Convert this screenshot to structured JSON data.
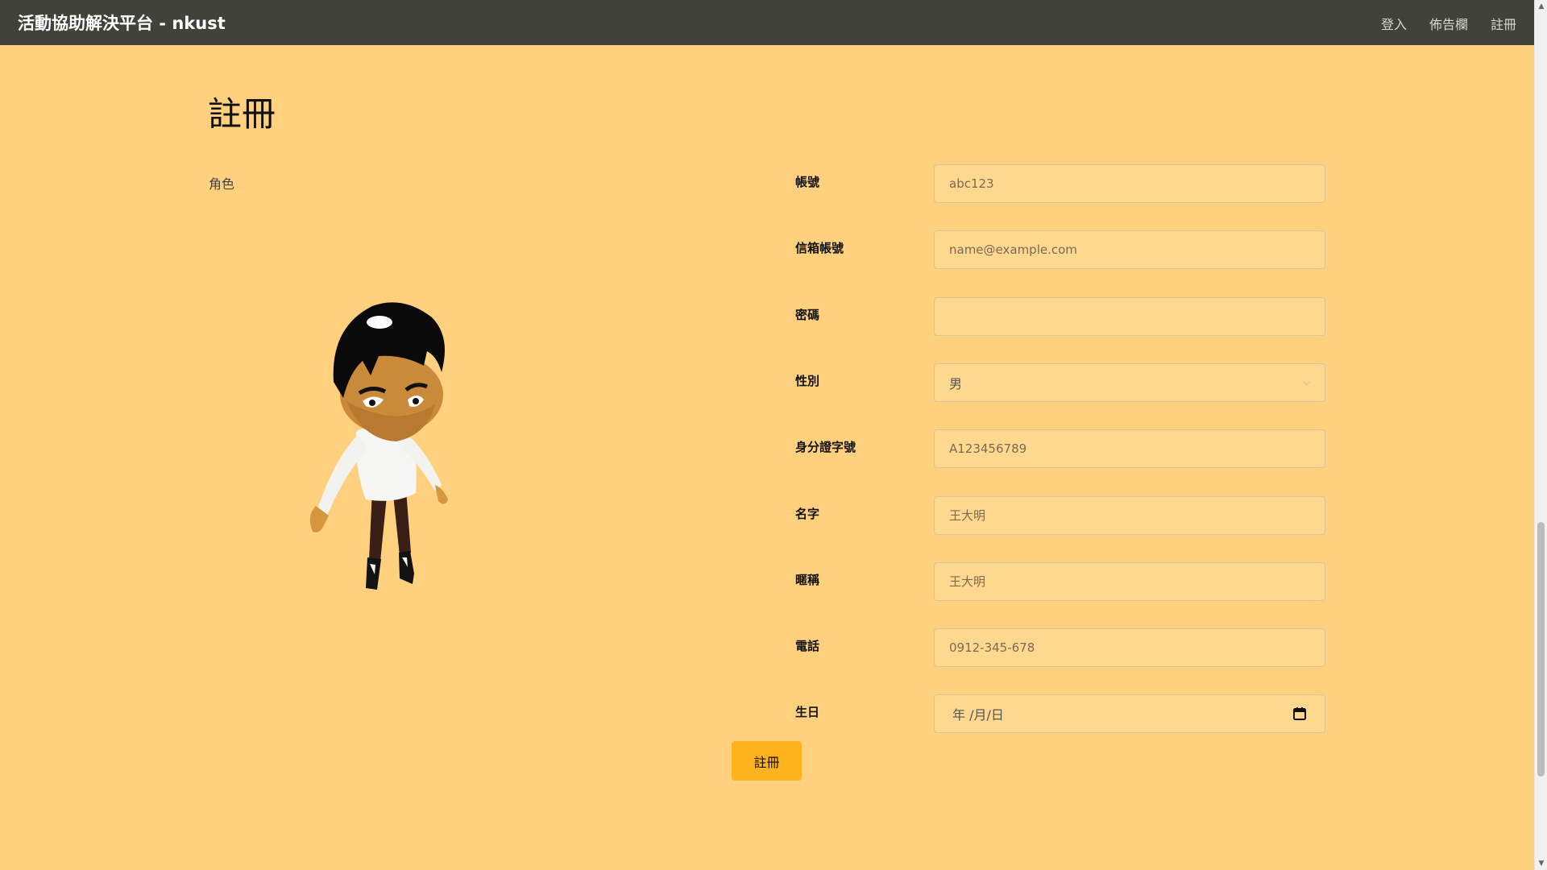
{
  "navbar": {
    "brand": "活動協助解決平台 - nkust",
    "links": [
      "登入",
      "佈告欄",
      "註冊"
    ]
  },
  "page": {
    "title": "註冊",
    "role_label": "角色"
  },
  "form": {
    "fields": [
      {
        "label": "帳號",
        "placeholder": "abc123",
        "value": ""
      },
      {
        "label": "信箱帳號",
        "placeholder": "name@example.com",
        "value": ""
      },
      {
        "label": "密碼",
        "placeholder": "",
        "value": ""
      },
      {
        "label": "性別",
        "selected": "男"
      },
      {
        "label": "身分證字號",
        "placeholder": "A123456789",
        "value": ""
      },
      {
        "label": "名字",
        "placeholder": "王大明",
        "value": ""
      },
      {
        "label": "暱稱",
        "placeholder": "王大明",
        "value": ""
      },
      {
        "label": "電話",
        "placeholder": "0912-345-678",
        "value": ""
      },
      {
        "label": "生日",
        "date_display": "年 /月/日"
      }
    ],
    "submit_label": "註冊"
  },
  "colors": {
    "page_background": "#FFD07E",
    "navbar_background": "#414239",
    "input_background": "#FFD88F",
    "button_background": "#FFB31E"
  },
  "icons": {
    "gender_select": "chevron-down-icon",
    "birthday": "calendar-icon"
  }
}
